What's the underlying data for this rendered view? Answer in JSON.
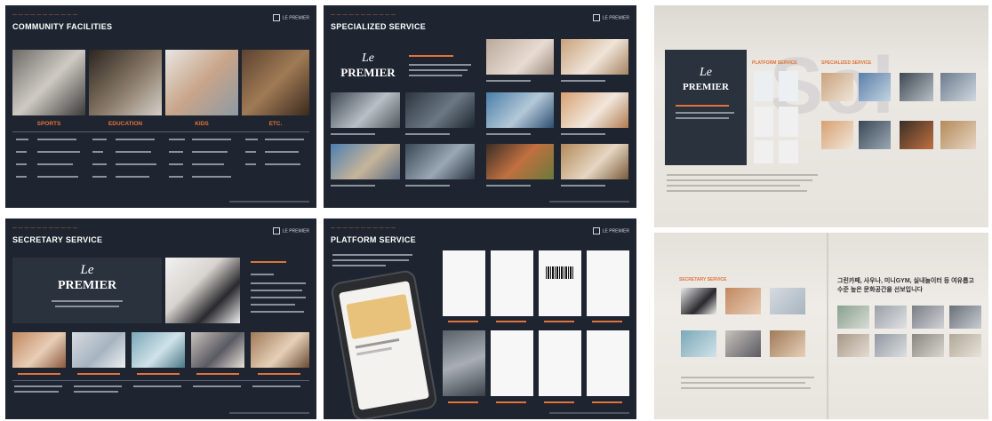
{
  "panels": {
    "community": {
      "title": "COMMUNITY FACILITIES",
      "logo": "LE PREMIER",
      "categories": [
        "SPORTS",
        "EDUCATION",
        "KIDS",
        "ETC."
      ]
    },
    "specialized": {
      "title": "SPECIALIZED SERVICE",
      "logo": "LE PREMIER",
      "brand_script": "Le",
      "brand": "PREMIER"
    },
    "secretary": {
      "title": "SECRETARY SERVICE",
      "logo": "LE PREMIER",
      "brand_script": "Le",
      "brand": "PREMIER"
    },
    "platform": {
      "title": "PLATFORM SERVICE",
      "logo": "LE PREMIER"
    }
  },
  "wall": {
    "top": {
      "brand_script": "Le",
      "brand": "PREMIER",
      "platform_label": "PLATFORM SERVICE",
      "specialized_label": "SPECIALIZED SERVICE",
      "watermark": "Sol"
    },
    "bottom": {
      "secretary_label": "SECRETARY SERVICE",
      "korean_text": "그린카페, 사우나, 미니GYM, 실내놀이터 등 여유롭고 수준 높은 문화공간을 선보입니다"
    }
  },
  "colors": {
    "panel_bg": "#1e2530",
    "accent": "#e0733a",
    "wall": "#ebe9e6"
  }
}
